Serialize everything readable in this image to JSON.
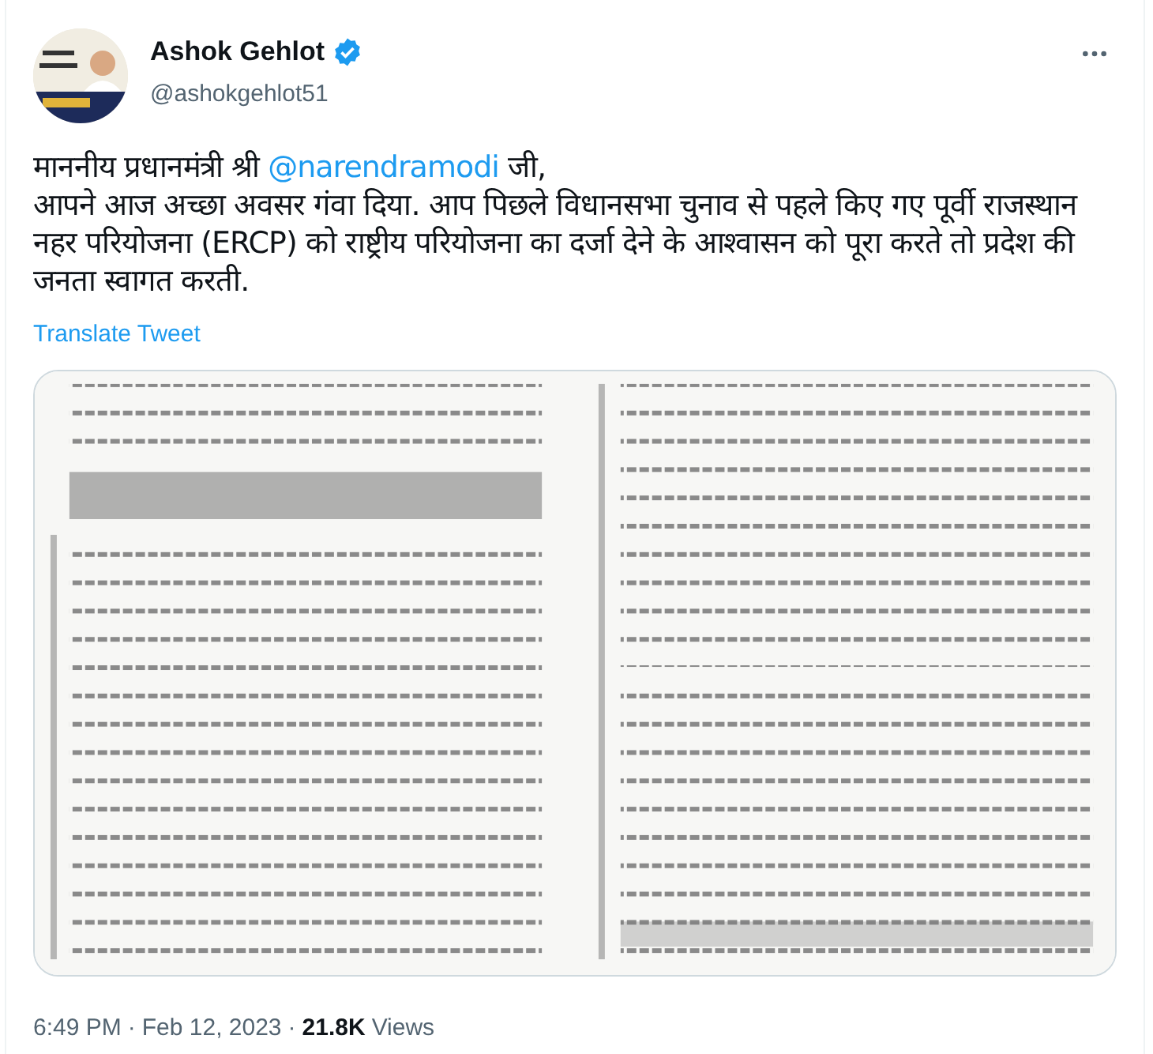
{
  "author": {
    "name": "Ashok Gehlot",
    "handle": "@ashokgehlot51",
    "verified": true
  },
  "tweet": {
    "before": "माननीय प्रधानमंत्री श्री ",
    "mention": "@narendramodi",
    "after": " जी,",
    "body": "आपने आज अच्छा अवसर गंवा दिया. आप पिछले विधानसभा चुनाव से पहले किए गए पूर्वी राजस्थान नहर परियोजना (ERCP) को राष्ट्रीय परियोजना का दर्जा देने के आश्वासन को पूरा करते तो प्रदेश की जनता स्वागत करती."
  },
  "translate": "Translate Tweet",
  "footer": {
    "time": "6:49 PM",
    "separator": "·",
    "date": "Feb 12, 2023",
    "views_count": "21.8K",
    "views_label": "Views"
  }
}
